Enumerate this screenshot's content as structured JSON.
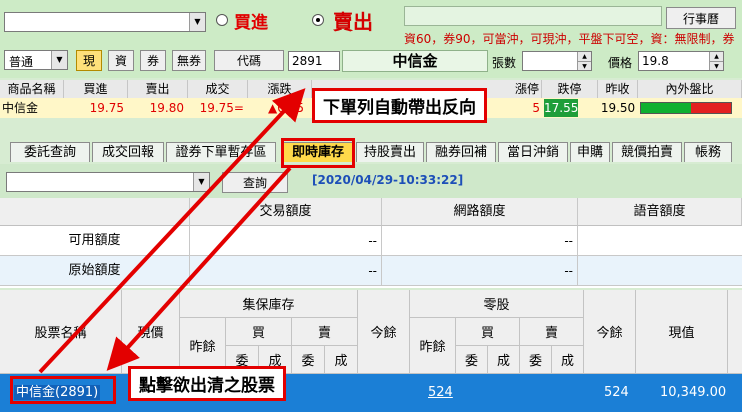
{
  "order": {
    "account_value": "",
    "buy_label": "買進",
    "sell_label": "賣出",
    "calendar_button": "行事曆",
    "order_type": "普通",
    "cash_button": "現",
    "margin_button": "資",
    "short_button": "券",
    "no_short_button": "無券",
    "code_button": "代碼",
    "code_value": "2891",
    "stock_name": "中信金",
    "info_text": "資60，券90，可當沖，可現沖，平盤下可空，資：無限制，券",
    "qty_label": "張數",
    "qty_value": "",
    "price_label": "價格",
    "price_value": "19.8"
  },
  "quote": {
    "headers": [
      "商品名稱",
      "買進",
      "賣出",
      "成交",
      "漲跌",
      "漲停",
      "跌停",
      "昨收",
      "內外盤比"
    ],
    "name": "中信金",
    "bid": "19.75",
    "ask": "19.80",
    "last": "19.75=",
    "change": "▲0.25",
    "limit_up": "5",
    "limit_down": "17.55",
    "prev_close": "19.50",
    "in_out_ratio": 0.55
  },
  "tabs": [
    "委託查詢",
    "成交回報",
    "證券下單暫存區",
    "即時庫存",
    "持股賣出",
    "融券回補",
    "當日沖銷",
    "申購",
    "競價拍賣",
    "帳務"
  ],
  "query": {
    "filter_value": "",
    "query_button": "查詢",
    "timestamp": "[2020/04/29-10:33:22]"
  },
  "quota": {
    "headers": [
      "交易額度",
      "網路額度",
      "語音額度"
    ],
    "rows": [
      {
        "label": "可用額度",
        "values": [
          "--",
          "--",
          ""
        ]
      },
      {
        "label": "原始額度",
        "values": [
          "--",
          "--",
          ""
        ]
      }
    ]
  },
  "inventory": {
    "h_stock": "股票名稱",
    "h_price": "現價",
    "h_custody": "集保庫存",
    "h_odd": "零股",
    "h_prev": "昨餘",
    "h_buy": "買",
    "h_sell": "賣",
    "h_order": "委",
    "h_filled": "成",
    "h_today": "今餘",
    "h_value": "現值",
    "row": {
      "stock": "中信金(2891)",
      "custody_prev": "524",
      "odd_today": "524",
      "value": "10,349.00"
    }
  },
  "callouts": {
    "top": "下單列自動帶出反向",
    "bottom": "點擊欲出清之股票"
  },
  "colors": {
    "panel_bg": "#cdebc6",
    "alert_red": "#e30000",
    "selected_row": "#1b7fd6",
    "active_tab": "#ffd94a"
  }
}
